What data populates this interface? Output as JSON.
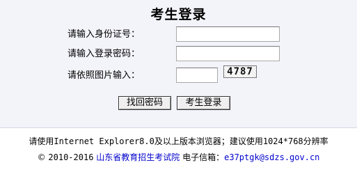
{
  "page": {
    "title": "考生登录"
  },
  "form": {
    "id_label": "请输入身份证号：",
    "id_value": "",
    "password_label": "请输入登录密码：",
    "password_value": "",
    "captcha_label": "请依照图片输入：",
    "captcha_value": "",
    "captcha_text": "4787"
  },
  "buttons": {
    "retrieve_password": "找回密码",
    "login": "考生登录"
  },
  "footer": {
    "browser_prefix": "请使用",
    "browser_name": "Internet Explorer8.0",
    "browser_middle": "及以上版本浏览器；建议使用",
    "resolution": "1024*768",
    "browser_suffix": "分辨率",
    "copyright_symbol": "©",
    "years": "2010-2016",
    "org_name": "山东省教育招生考试院",
    "email_label": "电子信箱：",
    "email": "e37ptgk@sdzs.gov.cn"
  },
  "colors": {
    "band_background": "#f3f3fa",
    "link": "#0000cc"
  }
}
